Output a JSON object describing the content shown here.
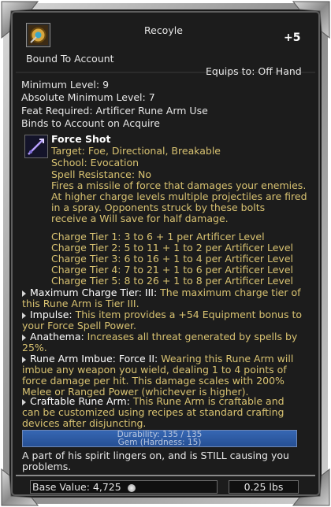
{
  "header": {
    "item_name": "Recoyle",
    "enhancement": "+5",
    "icon": "rune-arm-item-icon"
  },
  "binding": "Bound To Account",
  "equips": "Equips to: Off Hand",
  "requirements": [
    "Minimum Level: 9",
    "Absolute Minimum Level: 7",
    "Feat Required: Artificer Rune Arm Use",
    "Binds to Account on Acquire"
  ],
  "spell": {
    "icon": "force-shot-spell-icon",
    "name": "Force Shot",
    "target": "Target: Foe, Directional, Breakable",
    "school": "School: Evocation",
    "resistance": "Spell Resistance: No",
    "description": [
      "Fires a missile of force that damages your enemies.",
      " At higher charge levels multiple projectiles are fired",
      " in a spray. Opponents struck by these bolts",
      " receive a Will save for half damage."
    ],
    "charge_tiers": [
      "Charge Tier 1: 3 to 6 + 1 per Artificer Level",
      "Charge Tier 2: 5 to 11 + 1 to 2 per Artificer Level",
      "Charge Tier 3: 6 to 16 + 1 to 4 per Artificer Level",
      "Charge Tier 4: 7 to 21 + 1 to 6 per Artificer Level",
      "Charge Tier 5: 8 to 26 + 1 to 8 per Artificer Level"
    ]
  },
  "properties": [
    {
      "label": "Maximum Charge Tier: III:",
      "text": " The maximum charge tier of this Rune Arm is Tier III."
    },
    {
      "label": "Impulse:",
      "text": " This item provides a +54 Equipment bonus to your Force Spell Power."
    },
    {
      "label": "Anathema:",
      "text": " Increases all threat generated by spells by 25%."
    },
    {
      "label": "Rune Arm Imbue: Force II:",
      "text": " Wearing this Rune Arm will imbue any weapon you wield, dealing 1 to 4 points of force damage per hit. This damage scales with 200% Melee or Ranged Power (whichever is higher)."
    },
    {
      "label": "Craftable Rune Arm:",
      "text": " This Rune Arm is craftable and can be customized using recipes at standard crafting devices after disjuncting."
    }
  ],
  "durability": {
    "text": "Durability: 135 / 135",
    "material": "Gem (Hardness: 15)",
    "fraction": 1.0,
    "color": "#2e5ea8"
  },
  "flavor": "A part of his spirit lingers on, and is STILL causing you problems.",
  "footer": {
    "base_value": "Base Value: 4,725",
    "coin_icon": "platinum-coin-icon",
    "weight": "0.25 lbs"
  }
}
